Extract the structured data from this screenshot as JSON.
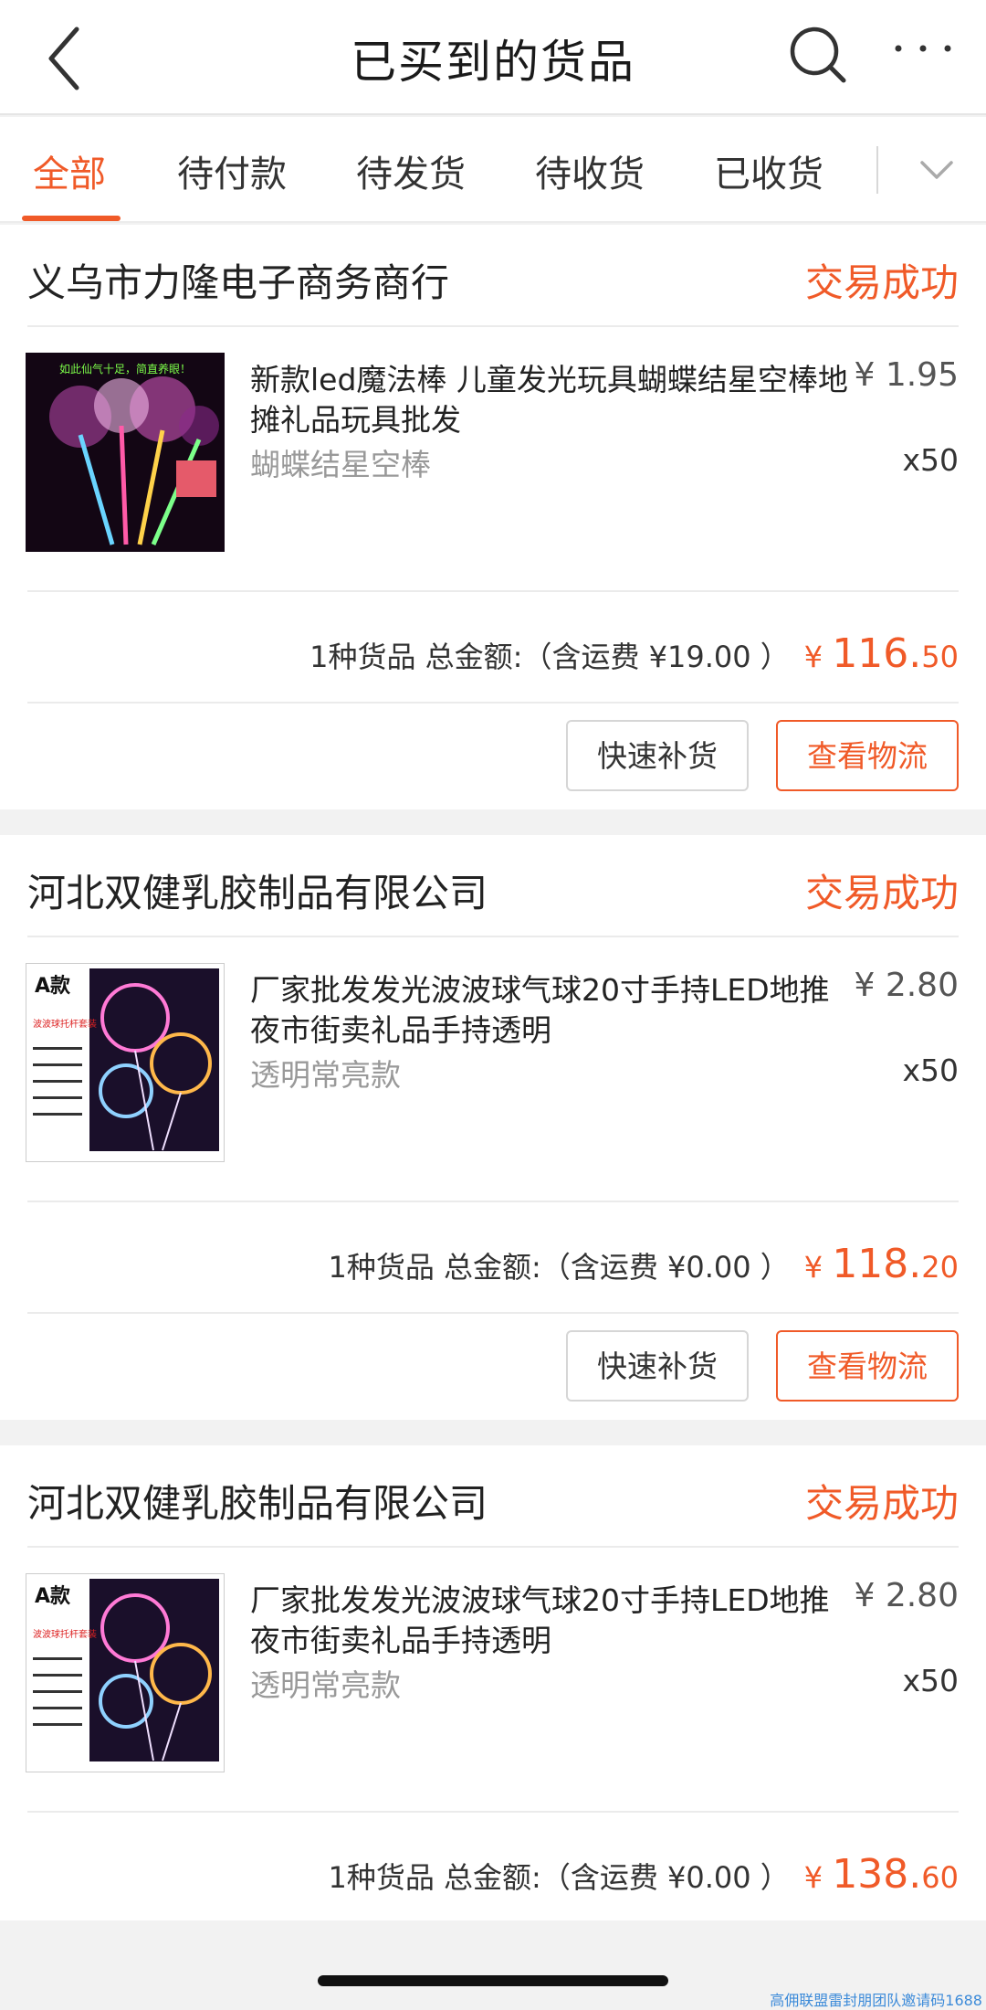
{
  "header": {
    "title": "已买到的货品"
  },
  "tabs": [
    "全部",
    "待付款",
    "待发货",
    "待收货",
    "已收货"
  ],
  "orders": [
    {
      "shop": "义乌市力隆电子商务商行",
      "status": "交易成功",
      "product": {
        "title": "新款led魔法棒 儿童发光玩具蝴蝶结星空棒地摊礼品玩具批发",
        "price": "¥ 1.95",
        "spec": "蝴蝶结星空棒",
        "qty": "x50",
        "thumb_text": "如此仙气十足，简直养眼！"
      },
      "summary_text": "1种货品 总金额:（含运费 ¥19.00 ）",
      "total_currency": "¥",
      "total_int": "116.",
      "total_dec": "50",
      "buttons": {
        "refill": "快速补货",
        "track": "查看物流"
      }
    },
    {
      "shop": "河北双健乳胶制品有限公司",
      "status": "交易成功",
      "product": {
        "title": "厂家批发发光波波球气球20寸手持LED地推夜市街卖礼品手持透明",
        "price": "¥ 2.80",
        "spec": "透明常亮款",
        "qty": "x50",
        "thumb_title": "A款",
        "thumb_sub": "波波球托杆套装"
      },
      "summary_text": "1种货品 总金额:（含运费 ¥0.00 ）",
      "total_currency": "¥",
      "total_int": "118.",
      "total_dec": "20",
      "buttons": {
        "refill": "快速补货",
        "track": "查看物流"
      }
    },
    {
      "shop": "河北双健乳胶制品有限公司",
      "status": "交易成功",
      "product": {
        "title": "厂家批发发光波波球气球20寸手持LED地推夜市街卖礼品手持透明",
        "price": "¥ 2.80",
        "spec": "透明常亮款",
        "qty": "x50",
        "thumb_title": "A款",
        "thumb_sub": "波波球托杆套装"
      },
      "summary_text": "1种货品 总金额:（含运费 ¥0.00 ）",
      "total_currency": "¥",
      "total_int": "138.",
      "total_dec": "60"
    }
  ],
  "watermark": "高佣联盟雷封朋团队邀请码1688",
  "colors": {
    "accent": "#f05a28",
    "text": "#222222",
    "muted": "#999999"
  }
}
